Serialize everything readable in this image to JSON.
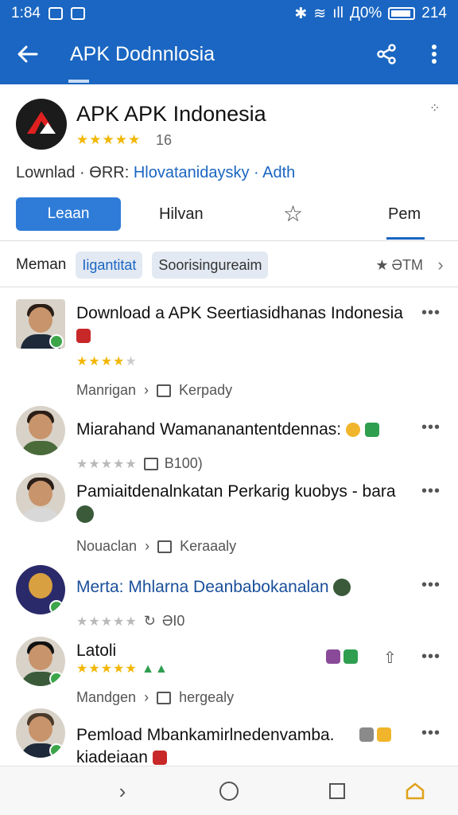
{
  "status": {
    "time": "1:84",
    "battery_text": "Д0%",
    "right_code": "214"
  },
  "appbar": {
    "title": "APK Dodnnlosia"
  },
  "app": {
    "name": "APK APK Indonesia",
    "rating": "16",
    "download_prefix": "Lownlad · ӨRR:",
    "download_link": "Hlovatanidaysky · Adth",
    "learn_label": "Leaan",
    "hilvan_label": "Hilvan",
    "pem_label": "Pem"
  },
  "chips": {
    "plain": "Meman",
    "chip1": "Iigantitat",
    "chip2": "Soorisingureaim",
    "star_label": "ƏTM"
  },
  "items": [
    {
      "title": "Download a APK Seertiasidhanas Indonesia",
      "stars": "★★★★★",
      "meta1": "Manrigan",
      "meta2": "Kerpady"
    },
    {
      "title": "Miarahand Wamananantentdennas:",
      "stars": "★★★★★",
      "meta2": "B100)"
    },
    {
      "title": "Pamiaitdenalnkatan Perkarig kuobys - bara",
      "meta1": "Nouaclan",
      "meta2": "Keraaaly"
    },
    {
      "title": "Merta: Mhlarna Deanbabokanalan",
      "stars": "★★★★★",
      "meta2": "ƏI0"
    },
    {
      "title": "Latoli",
      "stars": "★★★★★",
      "meta1": "Mandgen",
      "meta2": "hergealy"
    },
    {
      "title": "Pemload Mbankamirlnedenvamba. kiadeiaan"
    }
  ],
  "icons": {
    "back": "arrow-left-icon",
    "share": "share-icon",
    "menu": "more-vertical-icon",
    "star": "star-outline-icon",
    "chevron": "chevron-right-icon",
    "nav_back": "nav-back-icon",
    "nav_home": "nav-home-icon",
    "nav_recent": "nav-recent-icon"
  },
  "colors": {
    "primary": "#1a66c2",
    "star": "#f2b705",
    "button": "#2f7cd8"
  }
}
